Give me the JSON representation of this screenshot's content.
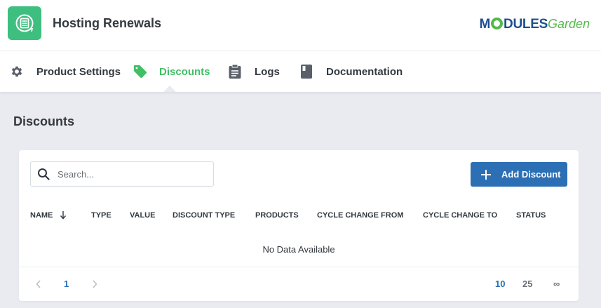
{
  "app": {
    "title": "Hosting Renewals",
    "brand_main": "MODULES",
    "brand_sub": "Garden"
  },
  "nav": [
    {
      "label": "Product Settings",
      "icon": "gear-icon",
      "active": false
    },
    {
      "label": "Discounts",
      "icon": "tag-icon",
      "active": true
    },
    {
      "label": "Logs",
      "icon": "clipboard-icon",
      "active": false
    },
    {
      "label": "Documentation",
      "icon": "book-icon",
      "active": false
    }
  ],
  "page": {
    "title": "Discounts"
  },
  "toolbar": {
    "search_placeholder": "Search...",
    "add_label": "Add Discount"
  },
  "table": {
    "columns": [
      "NAME",
      "TYPE",
      "VALUE",
      "DISCOUNT TYPE",
      "PRODUCTS",
      "CYCLE CHANGE FROM",
      "CYCLE CHANGE TO",
      "STATUS"
    ],
    "sort_column": "NAME",
    "empty_text": "No Data Available"
  },
  "pagination": {
    "current_page": "1",
    "per_page_options": [
      "10",
      "25",
      "∞"
    ],
    "per_page_selected": "10"
  },
  "colors": {
    "accent_green": "#41bf67",
    "primary_blue": "#2c6fb4",
    "background": "#e9ebf0"
  }
}
